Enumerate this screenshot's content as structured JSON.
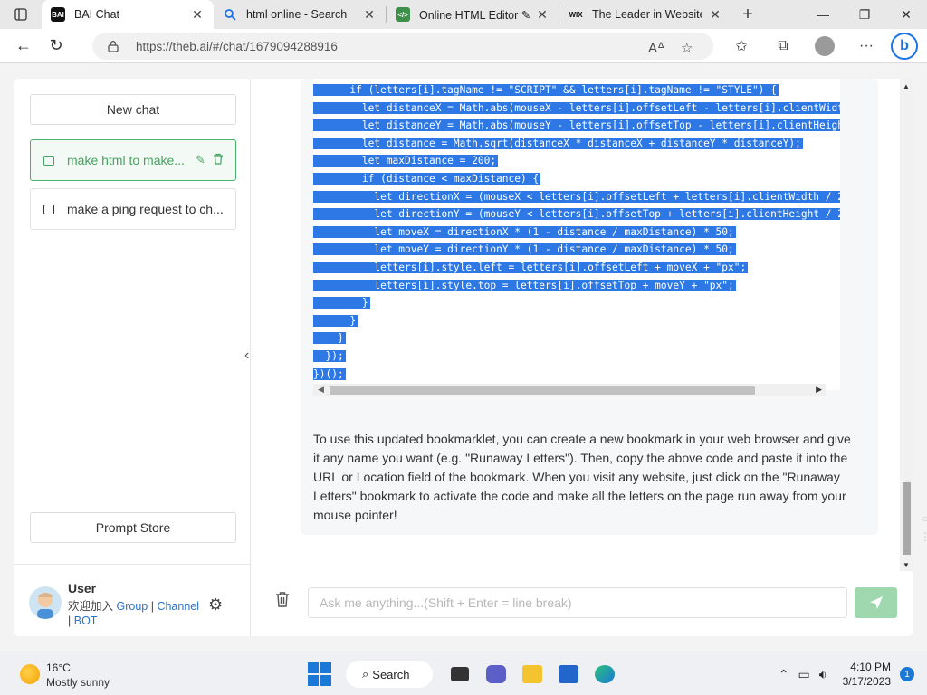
{
  "browser": {
    "tabs": [
      {
        "title": "BAI Chat",
        "favicon": "BAI",
        "active": true
      },
      {
        "title": "html online - Search",
        "favicon": "search-icon",
        "active": false
      },
      {
        "title": "Online HTML Editor ✎ |",
        "favicon": "code-icon",
        "active": false
      },
      {
        "title": "The Leader in Website C",
        "favicon": "WIX",
        "active": false
      }
    ],
    "url": "https://theb.ai/#/chat/1679094288916"
  },
  "sidebar": {
    "new_chat_label": "New chat",
    "chats": [
      {
        "title": "make html to make...",
        "active": true
      },
      {
        "title": "make a ping request to ch...",
        "active": false
      }
    ],
    "prompt_store_label": "Prompt Store",
    "user": {
      "name": "User",
      "join_text": "欢迎加入",
      "link_group": "Group",
      "sep1": " | ",
      "link_channel": "Channel",
      "sep2": " |",
      "link_bot": "BOT"
    }
  },
  "chat": {
    "code_lines": [
      "      if (letters[i].tagName != \"SCRIPT\" && letters[i].tagName != \"STYLE\") {",
      "        let distanceX = Math.abs(mouseX - letters[i].offsetLeft - letters[i].clientWidt",
      "        let distanceY = Math.abs(mouseY - letters[i].offsetTop - letters[i].clientHeigh",
      "        let distance = Math.sqrt(distanceX * distanceX + distanceY * distanceY);",
      "        let maxDistance = 200;",
      "        if (distance < maxDistance) {",
      "          let directionX = (mouseX < letters[i].offsetLeft + letters[i].clientWidth / 2",
      "          let directionY = (mouseY < letters[i].offsetTop + letters[i].clientHeight / 2",
      "          let moveX = directionX * (1 - distance / maxDistance) * 50;",
      "          let moveY = directionY * (1 - distance / maxDistance) * 50;",
      "          letters[i].style.left = letters[i].offsetLeft + moveX + \"px\";",
      "          letters[i].style.top = letters[i].offsetTop + moveY + \"px\";",
      "        }",
      "      }",
      "    }",
      "  });",
      "})();"
    ],
    "message_text": "To use this updated bookmarklet, you can create a new bookmark in your web browser and give it any name you want (e.g. \"Runaway Letters\"). Then, copy the above code and paste it into the URL or Location field of the bookmark. When you visit any website, just click on the \"Runaway Letters\" bookmark to activate the code and make all the letters on the page run away from your mouse pointer!",
    "input_placeholder": "Ask me anything...(Shift + Enter = line break)"
  },
  "taskbar": {
    "temperature": "16°C",
    "weather": "Mostly sunny",
    "search_label": "Search",
    "time": "4:10 PM",
    "date": "3/17/2023",
    "notifications": "1"
  },
  "colors": {
    "accent_green": "#46b46a",
    "send_button": "#9fd8ae",
    "selection_blue": "#2d78e4",
    "link_blue": "#2a73c9"
  }
}
